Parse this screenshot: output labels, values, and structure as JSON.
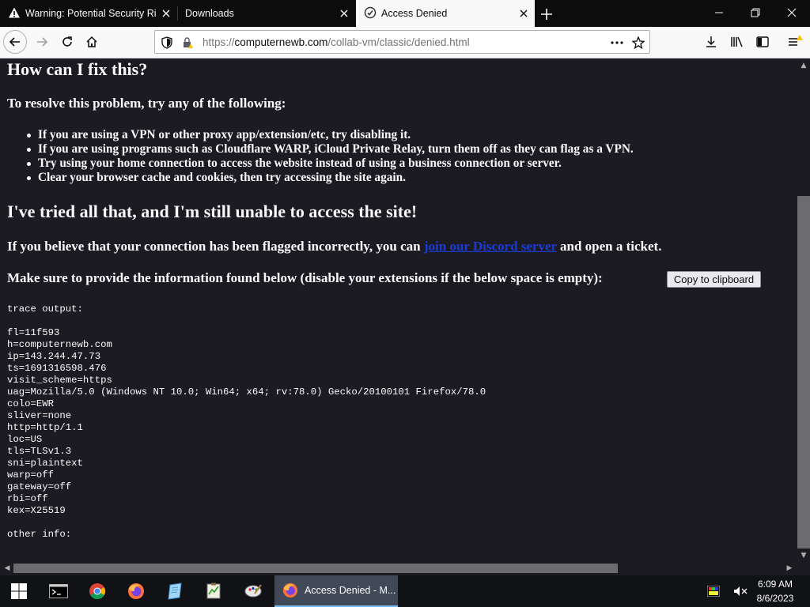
{
  "browser": {
    "tabs": [
      {
        "label": "Warning: Potential Security Risk Ahead",
        "icon": "warning-icon",
        "active": false
      },
      {
        "label": "Downloads",
        "icon": "",
        "active": false
      },
      {
        "label": "Access Denied",
        "icon": "shield-badge-icon",
        "active": true
      }
    ],
    "url": {
      "prefix": "https://",
      "domain": "computernewb.com",
      "path": "/collab-vm/classic/denied.html"
    },
    "icons": [
      "back-icon",
      "forward-icon",
      "reload-icon",
      "home-icon",
      "tracking-shield-icon",
      "lock-icon",
      "page-actions-icon",
      "bookmark-star-icon",
      "downloads-icon",
      "library-icon",
      "sidebar-icon",
      "menu-icon"
    ]
  },
  "page": {
    "heading_fix": "How can I fix this?",
    "resolve_intro": "To resolve this problem, try any of the following:",
    "fix_items": [
      "If you are using a VPN or other proxy app/extension/etc, try disabling it.",
      "If you are using programs such as Cloudflare WARP, iCloud Private Relay, turn them off as they can flag as a VPN.",
      "Try using your home connection to access the website instead of using a business connection or server.",
      "Clear your browser cache and cookies, then try accessing the site again."
    ],
    "heading_still": "I've tried all that, and I'm still unable to access the site!",
    "flagged_before": "If you believe that your connection has been flagged incorrectly, you can ",
    "flagged_link": "join our Discord server",
    "flagged_after": " and open a ticket.",
    "provide_info": "Make sure to provide the information found below (disable your extensions if the below space is empty):",
    "copy_button": "Copy to clipboard",
    "trace_header": "trace output:",
    "trace_lines": [
      "fl=11f593",
      "h=computernewb.com",
      "ip=143.244.47.73",
      "ts=1691316598.476",
      "visit_scheme=https",
      "uag=Mozilla/5.0 (Windows NT 10.0; Win64; x64; rv:78.0) Gecko/20100101 Firefox/78.0",
      "colo=EWR",
      "sliver=none",
      "http=http/1.1",
      "loc=US",
      "tls=TLSv1.3",
      "sni=plaintext",
      "warp=off",
      "gateway=off",
      "rbi=off",
      "kex=X25519"
    ],
    "other_info": "other info:"
  },
  "taskbar": {
    "apps": [
      "start-icon",
      "terminal-icon",
      "chrome-icon",
      "firefox-icon",
      "notepad-icon",
      "task-manager-icon",
      "paint-icon"
    ],
    "active_window": "Access Denied - M...",
    "tray_icons": [
      "display-icon",
      "volume-muted-icon"
    ],
    "time": "6:09 AM",
    "date": "8/6/2023"
  },
  "colors": {
    "page_bg": "#1c1b22",
    "link": "#1a3bd6",
    "tab_active": "#f9f9fa",
    "tab_strip": "#0c0c0d"
  }
}
